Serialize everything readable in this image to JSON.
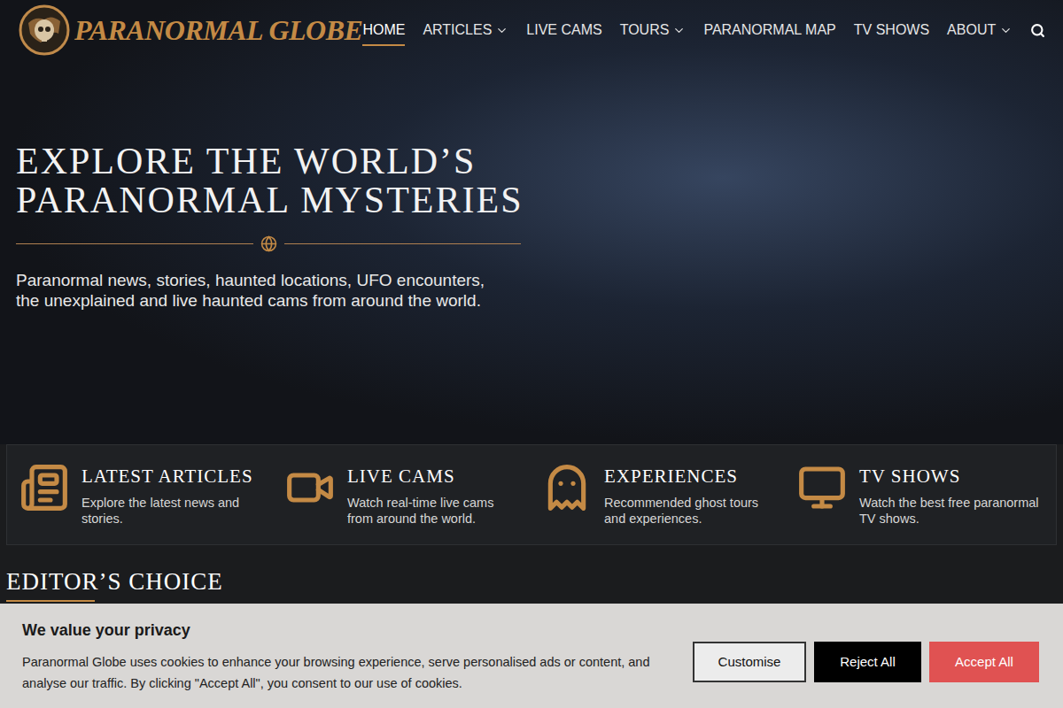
{
  "logo": {
    "text": "PARANORMAL GLOBE"
  },
  "nav": [
    {
      "label": "HOME",
      "selected": true,
      "dropdown": false
    },
    {
      "label": "ARTICLES",
      "selected": false,
      "dropdown": true
    },
    {
      "label": "LIVE CAMS",
      "selected": false,
      "dropdown": false
    },
    {
      "label": "TOURS",
      "selected": false,
      "dropdown": true
    },
    {
      "label": "PARANORMAL MAP",
      "selected": false,
      "dropdown": false
    },
    {
      "label": "TV SHOWS",
      "selected": false,
      "dropdown": false
    },
    {
      "label": "ABOUT",
      "selected": false,
      "dropdown": true
    }
  ],
  "hero": {
    "title_lines": [
      "EXPLORE THE WORLD’S",
      "PARANORMAL MYSTERIES"
    ],
    "subtitle": "Paranormal news, stories, haunted locations, UFO encounters, the unexplained and live haunted cams from around the world."
  },
  "features": [
    {
      "kind": "articles",
      "title": "LATEST ARTICLES",
      "text": "Explore the latest news and stories."
    },
    {
      "kind": "cams",
      "title": "LIVE CAMS",
      "text": "Watch real-time live cams from around the world."
    },
    {
      "kind": "experiences",
      "title": "EXPERIENCES",
      "text": "Recommended ghost tours and experiences."
    },
    {
      "kind": "tv",
      "title": "TV SHOWS",
      "text": "Watch the best free paranormal TV shows."
    }
  ],
  "section": {
    "title": "EDITOR’S CHOICE"
  },
  "cookie_banner": {
    "title": "We value your privacy",
    "text": "Paranormal Globe uses cookies to enhance your browsing experience, serve personalised ads or content, and analyse our traffic. By clicking \"Accept All\", you consent to our use of cookies.",
    "buttons": [
      {
        "label": "Customise",
        "kind": "outline"
      },
      {
        "label": "Reject All",
        "kind": "dark"
      },
      {
        "label": "Accept All",
        "kind": "primary"
      }
    ]
  }
}
